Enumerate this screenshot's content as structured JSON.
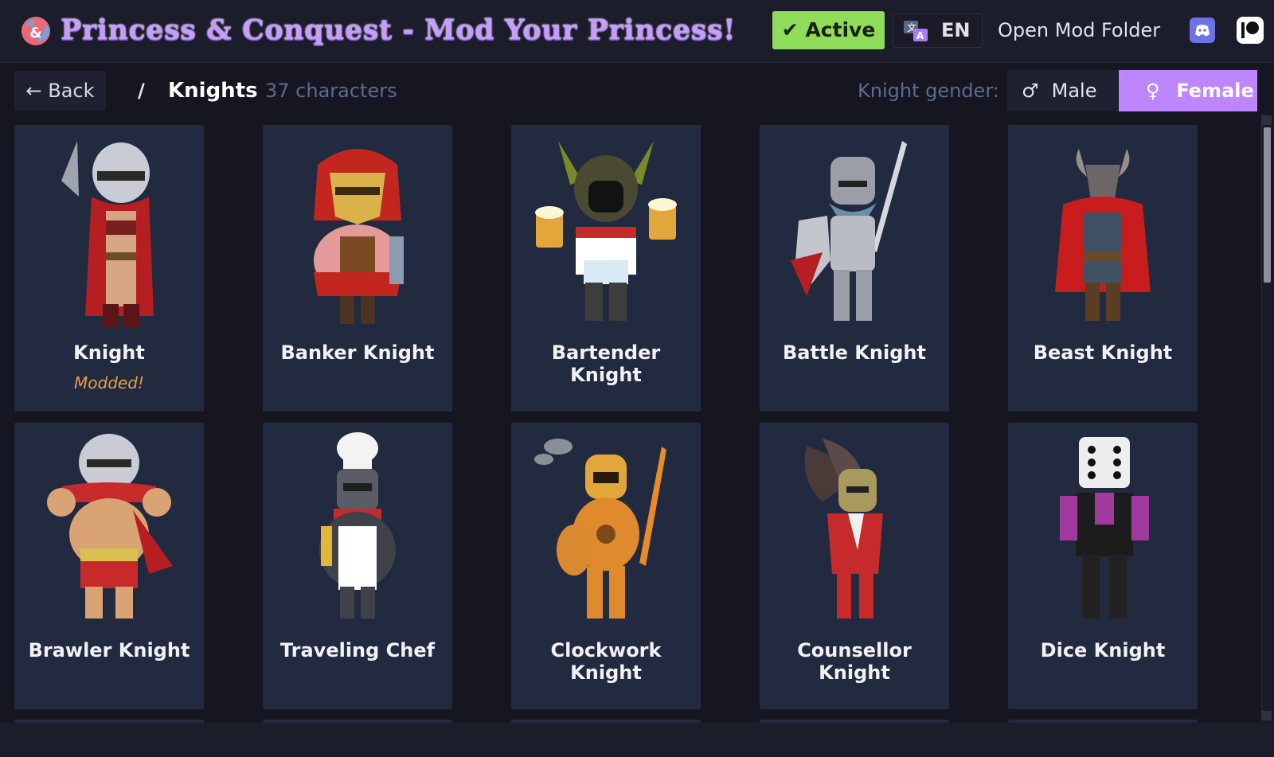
{
  "header": {
    "title": "Princess & Conquest - Mod Your Princess!",
    "active_label": "✔ Active",
    "language": "EN",
    "open_folder_label": "Open Mod Folder"
  },
  "toolbar": {
    "back_label": "← Back",
    "separator": "/",
    "category": "Knights",
    "count_text": "37  characters",
    "gender_label": "Knight gender:",
    "male_label": "Male",
    "female_label": "Female",
    "male_icon": "♂",
    "female_icon": "♀",
    "selected_gender": "Female"
  },
  "characters": [
    {
      "name": "Knight",
      "badge": "Modded!"
    },
    {
      "name": "Banker Knight",
      "badge": ""
    },
    {
      "name": "Bartender Knight",
      "badge": ""
    },
    {
      "name": "Battle Knight",
      "badge": ""
    },
    {
      "name": "Beast Knight",
      "badge": ""
    },
    {
      "name": "Brawler Knight",
      "badge": ""
    },
    {
      "name": "Traveling Chef",
      "badge": ""
    },
    {
      "name": "Clockwork Knight",
      "badge": ""
    },
    {
      "name": "Counsellor Knight",
      "badge": ""
    },
    {
      "name": "Dice Knight",
      "badge": ""
    }
  ],
  "icons": {
    "logo": "princess-and-conquest-logo-icon",
    "translate": "translate-icon",
    "discord": "discord-icon",
    "patreon": "patreon-icon"
  },
  "colors": {
    "background": "#15161f",
    "card": "#222a3f",
    "accent_purple": "#bd86ff",
    "active_green": "#8fdc5a",
    "modded_orange": "#e2a24c",
    "muted_text": "#5b6b92"
  }
}
